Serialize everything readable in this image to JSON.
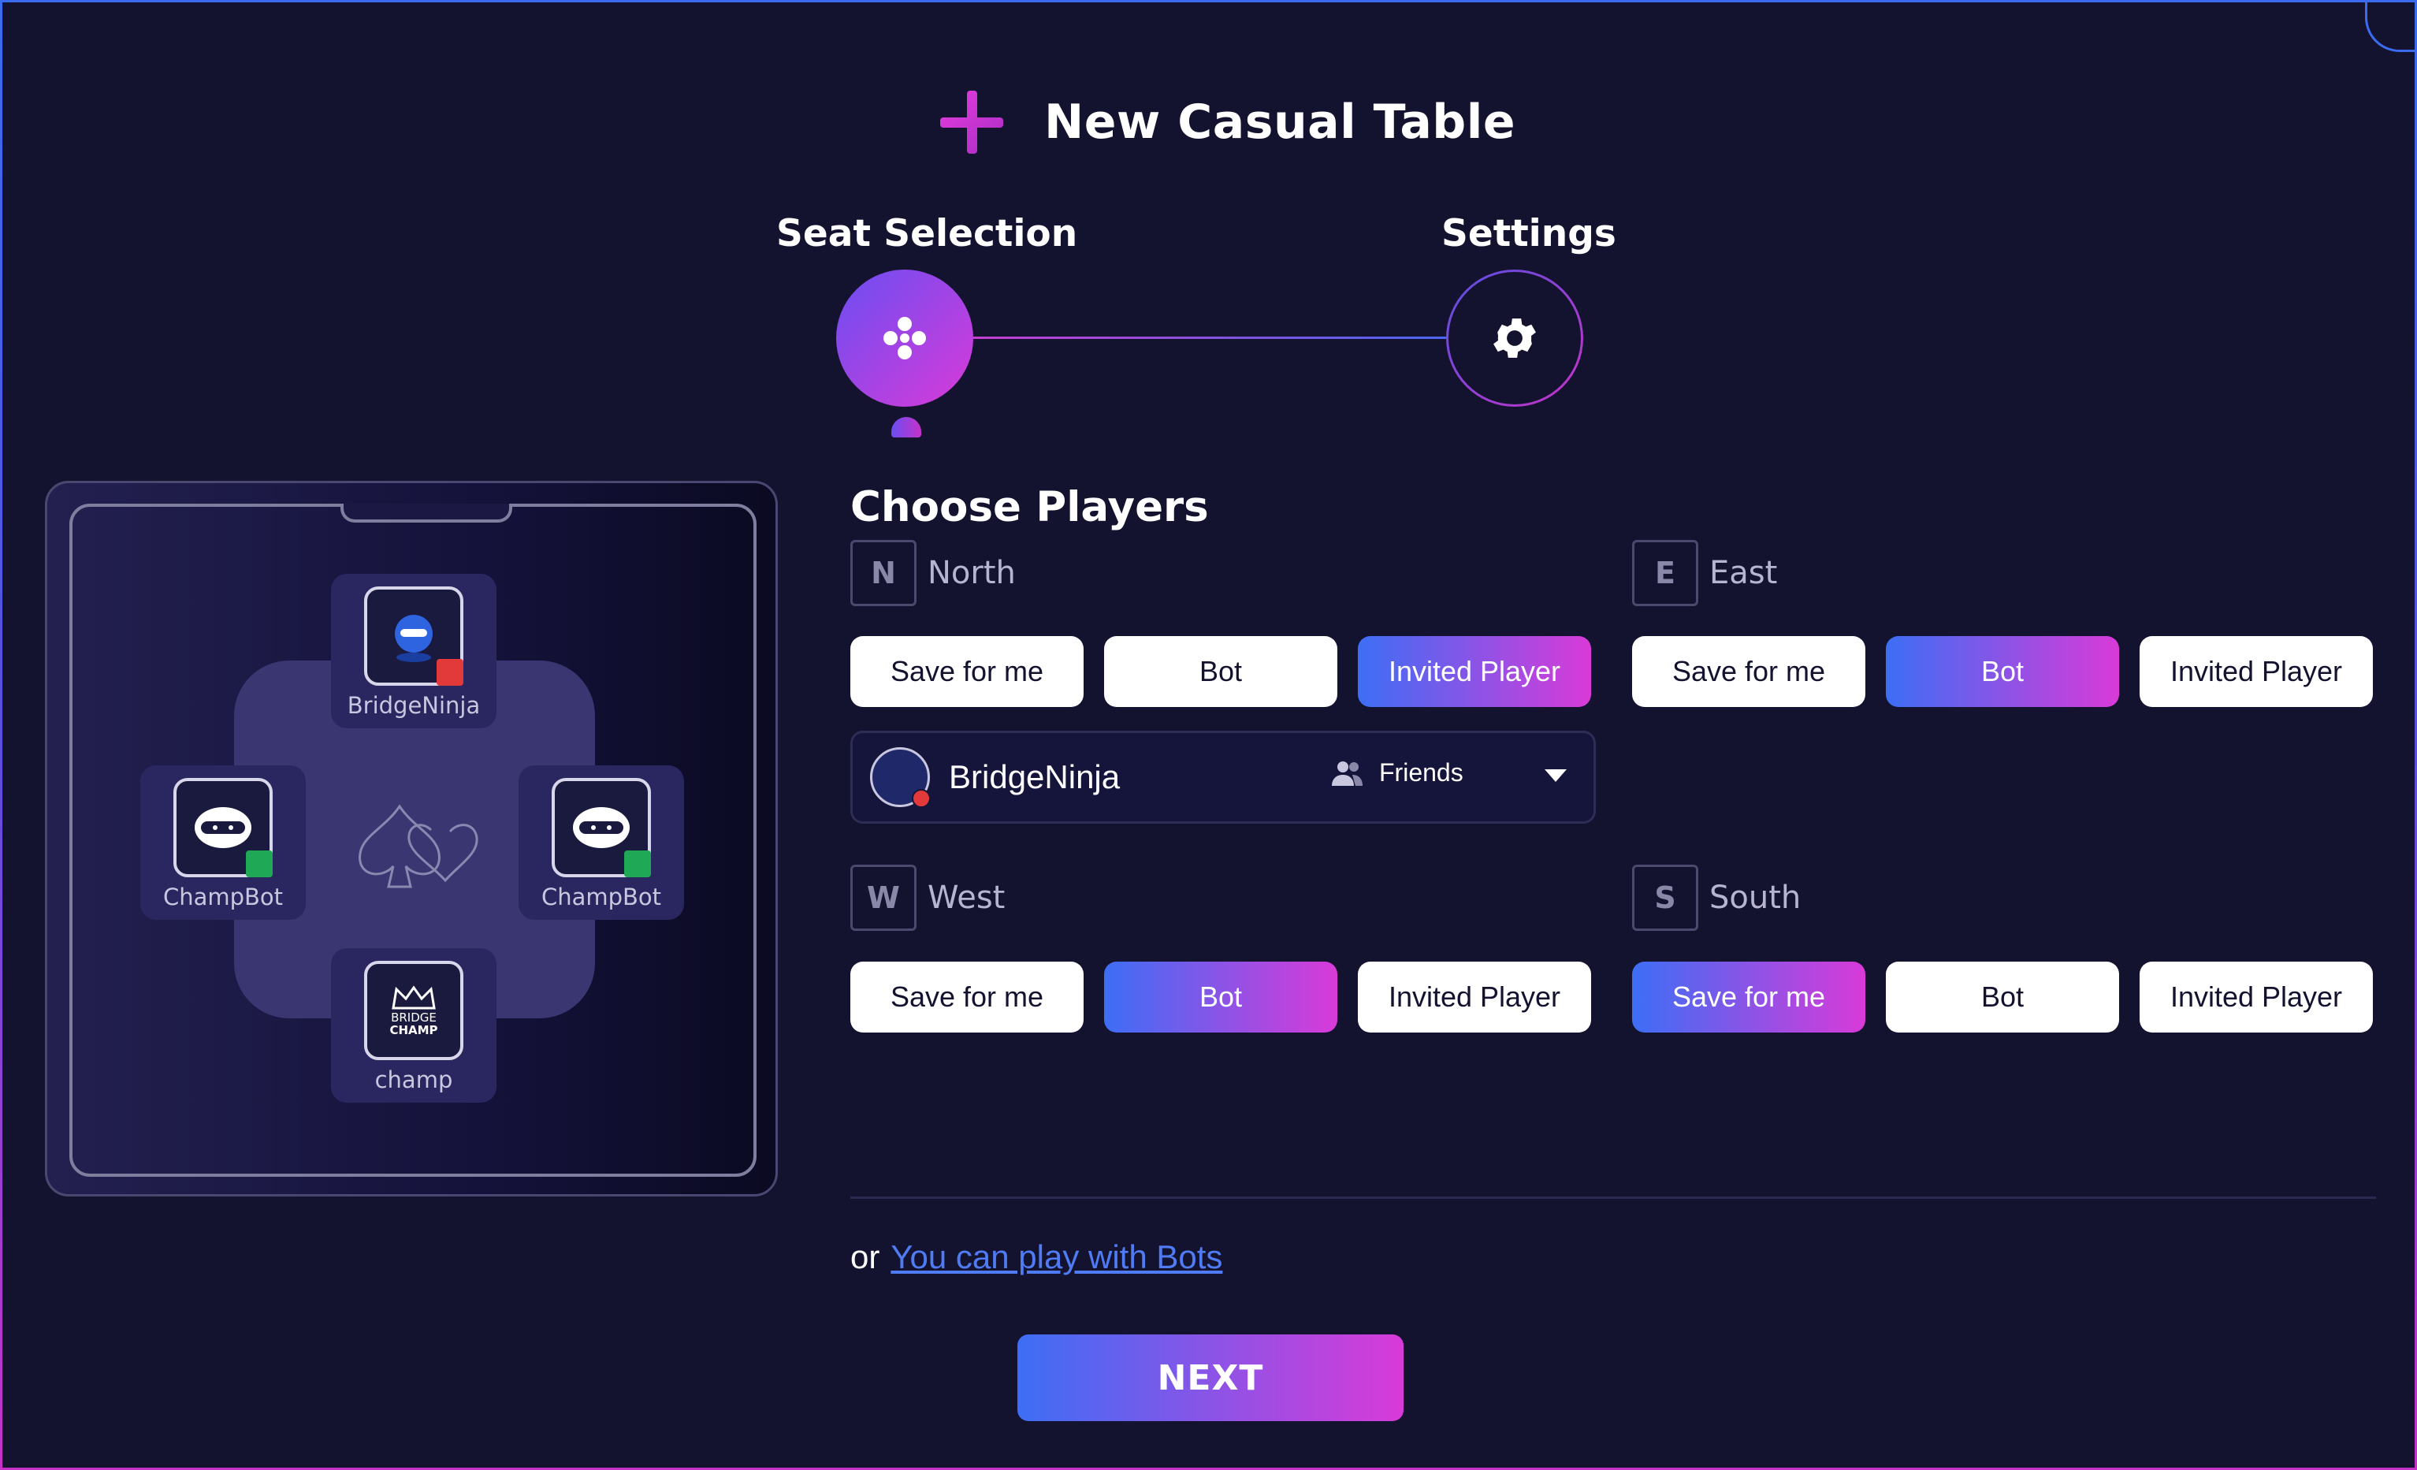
{
  "dialog": {
    "title": "New Casual Table"
  },
  "steps": [
    {
      "label": "Seat Selection",
      "icon": "dots-cross-icon",
      "active": true
    },
    {
      "label": "Settings",
      "icon": "gear-icon",
      "active": false
    }
  ],
  "table_preview": {
    "north": {
      "name": "BridgeNinja",
      "status_color": "#e23a3a"
    },
    "west": {
      "name": "ChampBot",
      "status_color": "#1fa855"
    },
    "east": {
      "name": "ChampBot",
      "status_color": "#1fa855"
    },
    "south": {
      "name": "champ",
      "logo_text": [
        "BRIDGE",
        "CHAMP"
      ]
    }
  },
  "choose_players": {
    "title": "Choose Players",
    "options": [
      "Save for me",
      "Bot",
      "Invited Player"
    ],
    "seats": {
      "north": {
        "letter": "N",
        "label": "North",
        "selected": "Invited Player"
      },
      "east": {
        "letter": "E",
        "label": "East",
        "selected": "Bot"
      },
      "west": {
        "letter": "W",
        "label": "West",
        "selected": "Bot"
      },
      "south": {
        "letter": "S",
        "label": "South",
        "selected": "Save for me"
      }
    },
    "invited": {
      "name": "BridgeNinja",
      "filter_label": "Friends"
    }
  },
  "footer": {
    "or_text": "or",
    "bots_link": "You can play with Bots",
    "next_label": "NEXT"
  },
  "colors": {
    "background": "#14132f",
    "accent_start": "#3d6ef5",
    "accent_end": "#d93ad8"
  }
}
